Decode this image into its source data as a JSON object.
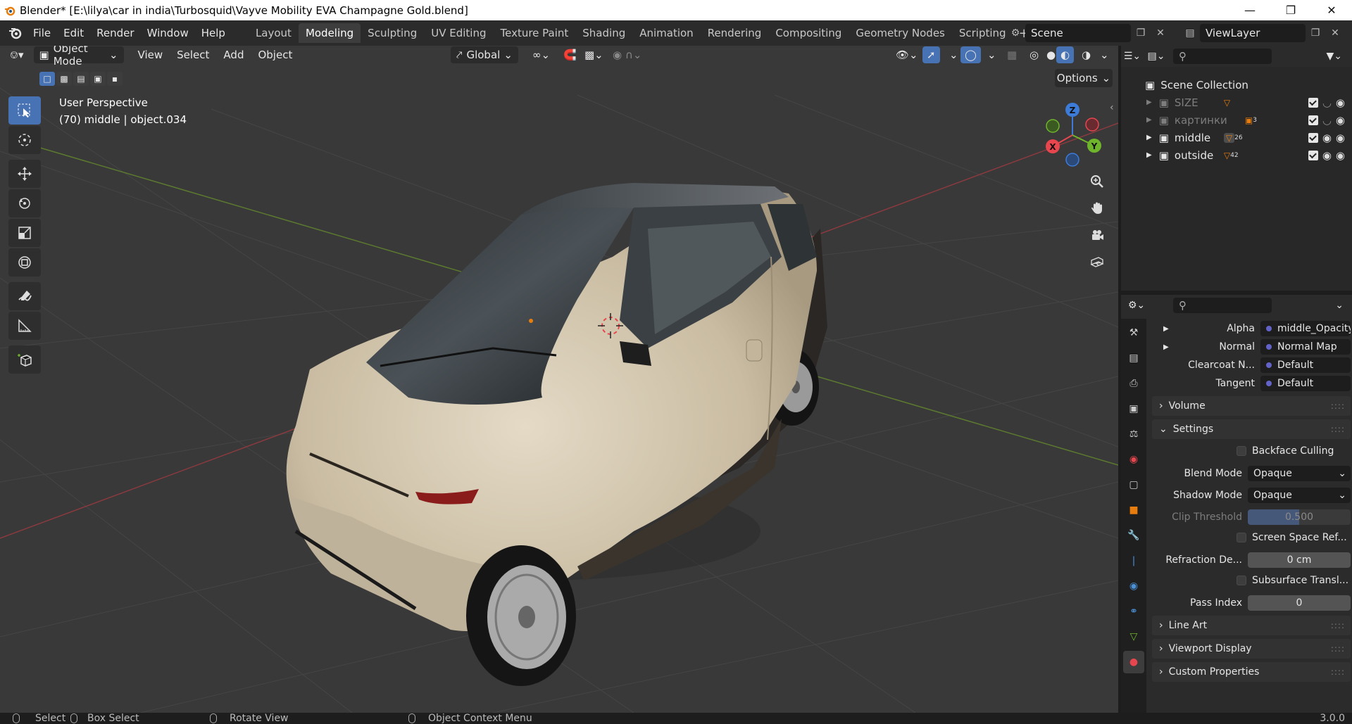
{
  "window": {
    "title": "Blender* [E:\\lilya\\car in india\\Turbosquid\\Vayve Mobility EVA Champagne Gold.blend]"
  },
  "menu": {
    "items": [
      "File",
      "Edit",
      "Render",
      "Window",
      "Help"
    ]
  },
  "workspaces": {
    "tabs": [
      "Layout",
      "Modeling",
      "Sculpting",
      "UV Editing",
      "Texture Paint",
      "Shading",
      "Animation",
      "Rendering",
      "Compositing",
      "Geometry Nodes",
      "Scripting"
    ],
    "active": "Modeling",
    "add": "+"
  },
  "scene": {
    "name": "Scene"
  },
  "viewlayer": {
    "name": "ViewLayer"
  },
  "viewport": {
    "mode": "Object Mode",
    "menus": [
      "View",
      "Select",
      "Add",
      "Object"
    ],
    "orientation": "Global",
    "options_label": "Options",
    "perspective": "User Perspective",
    "object_info": "(70) middle | object.034",
    "gizmo": {
      "x": "X",
      "y": "Y",
      "z": "Z"
    }
  },
  "outliner": {
    "root": "Scene Collection",
    "items": [
      {
        "name": "SIZE",
        "count": "",
        "dim": true
      },
      {
        "name": "картинки",
        "count": "3",
        "dim": true
      },
      {
        "name": "middle",
        "count": "26",
        "dim": false
      },
      {
        "name": "outside",
        "count": "42",
        "dim": false
      }
    ]
  },
  "properties": {
    "rows": {
      "alpha": {
        "label": "Alpha",
        "value": "middle_Opacity..."
      },
      "normal": {
        "label": "Normal",
        "value": "Normal Map"
      },
      "clearcoat": {
        "label": "Clearcoat N...",
        "value": "Default"
      },
      "tangent": {
        "label": "Tangent",
        "value": "Default"
      }
    },
    "sections": {
      "volume": "Volume",
      "settings": "Settings",
      "line_art": "Line Art",
      "viewport_display": "Viewport Display",
      "custom_props": "Custom Properties"
    },
    "settings": {
      "backface": "Backface Culling",
      "blend_label": "Blend Mode",
      "blend_value": "Opaque",
      "shadow_label": "Shadow Mode",
      "shadow_value": "Opaque",
      "clip_label": "Clip Threshold",
      "clip_value": "0.500",
      "ssr": "Screen Space Ref...",
      "refraction_label": "Refraction De...",
      "refraction_value": "0 cm",
      "sss": "Subsurface Transl...",
      "pass_label": "Pass Index",
      "pass_value": "0"
    }
  },
  "statusbar": {
    "select": "Select",
    "box_select": "Box Select",
    "rotate": "Rotate View",
    "context": "Object Context Menu",
    "version": "3.0.0"
  },
  "colors": {
    "accent": "#4772b3",
    "axis_x": "#e8464f",
    "axis_y": "#6fb52c",
    "axis_z": "#3d7bd9",
    "car_body": "#cfc3ac"
  }
}
